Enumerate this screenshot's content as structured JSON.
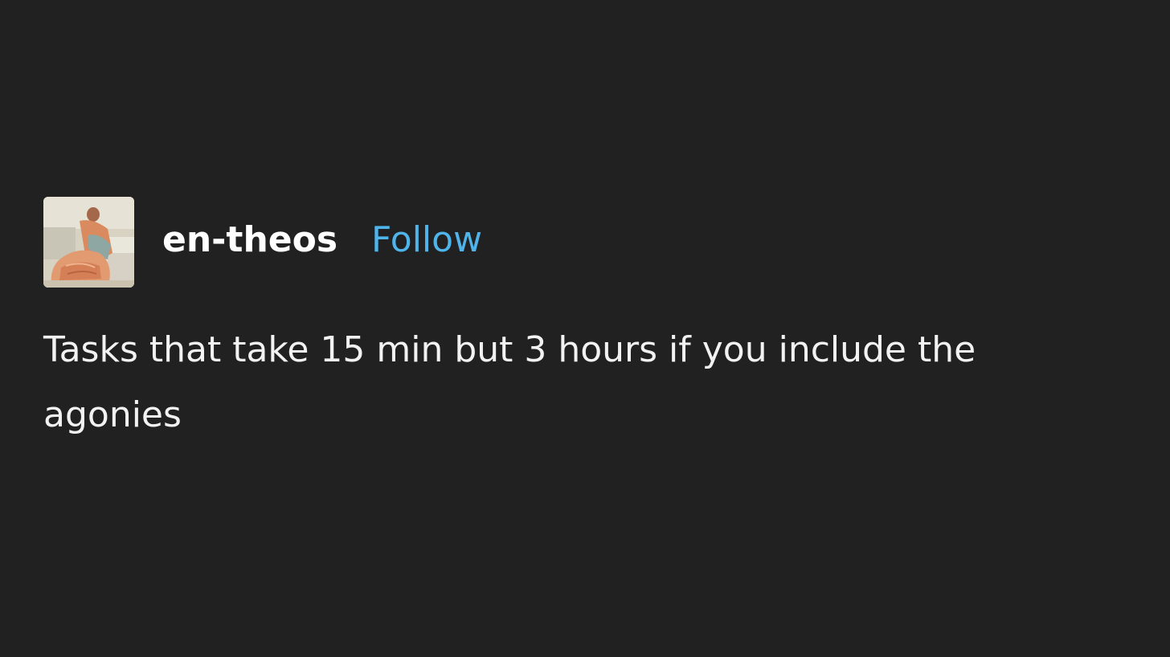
{
  "post": {
    "author": "en-theos",
    "follow_label": "Follow",
    "avatar_icon": "painting-avatar-icon",
    "body_text": "Tasks that take 15 min but 3 hours if you include the agonies"
  },
  "colors": {
    "background": "#212121",
    "text": "#f2f2f2",
    "follow": "#4fb4ea"
  }
}
